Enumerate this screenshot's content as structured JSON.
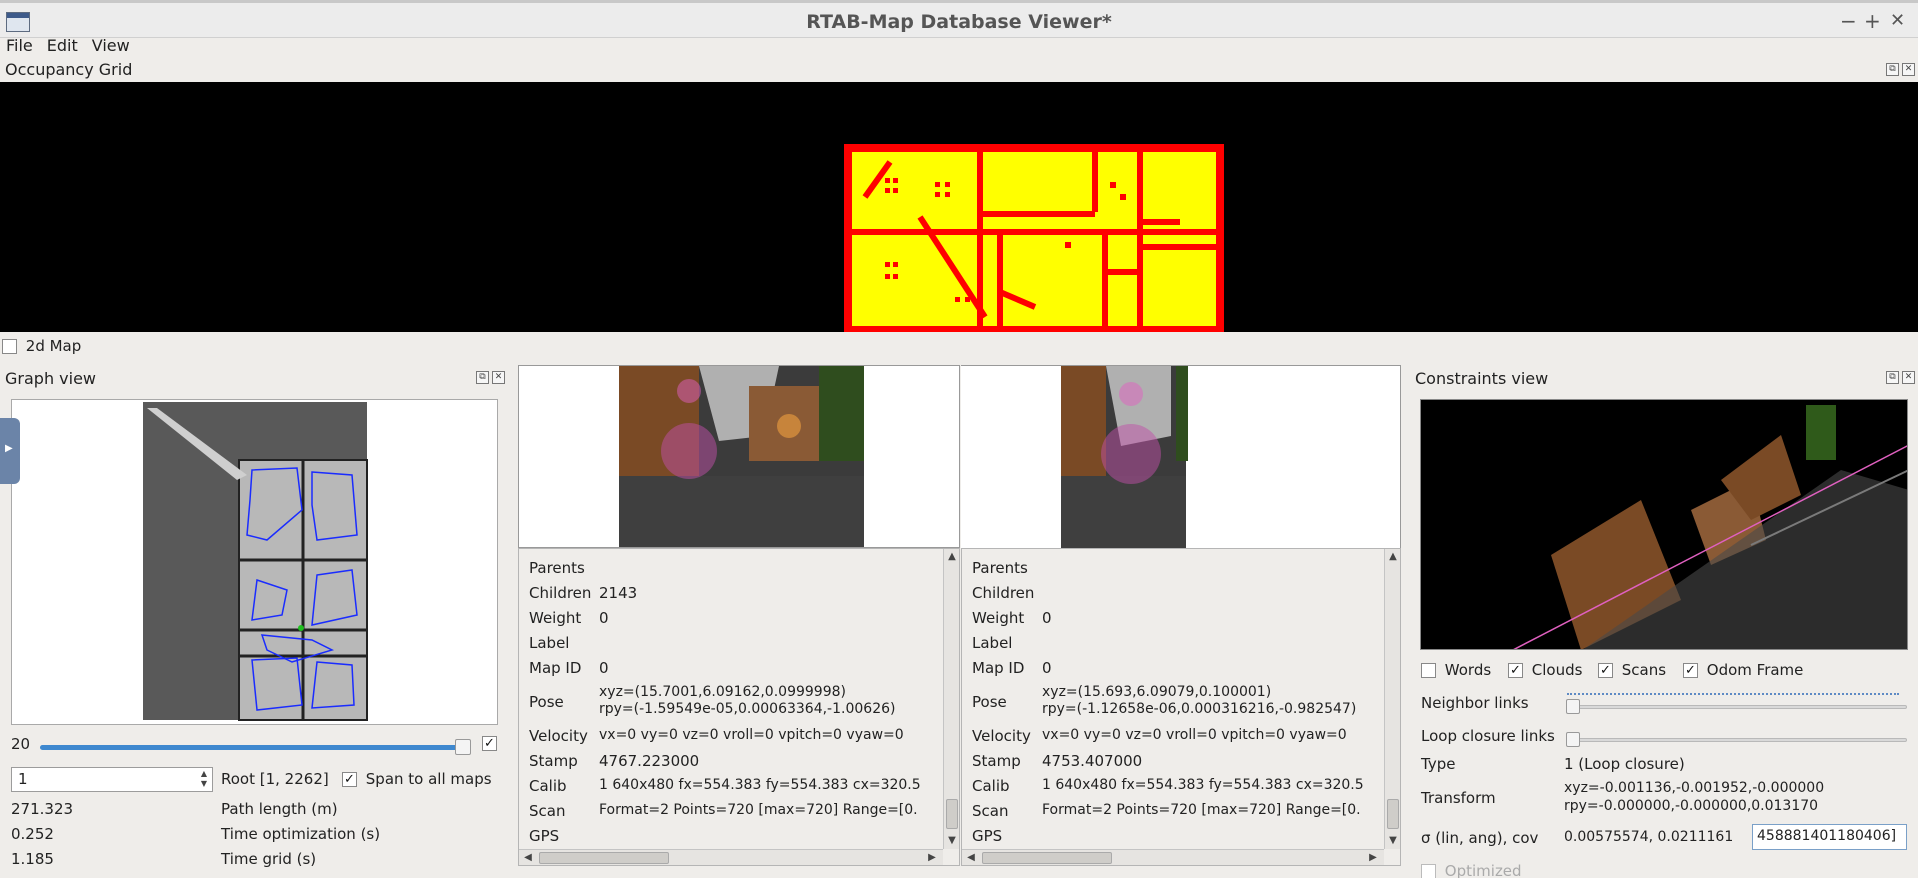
{
  "window": {
    "title": "RTAB-Map Database Viewer*",
    "minimize": "−",
    "maximize": "+",
    "close": "✕"
  },
  "menu": [
    "File",
    "Edit",
    "View"
  ],
  "occupancy": {
    "title": "Occupancy Grid",
    "map2d_label": "2d Map",
    "map2d_checked": false
  },
  "graph": {
    "title": "Graph view",
    "slider_value": "20",
    "root_spin_value": "1",
    "root_label": "Root [1, 2262]",
    "span_label": "Span to all maps",
    "span_checked": true,
    "stats": [
      {
        "value": "271.323",
        "label": "Path length (m)"
      },
      {
        "value": "0.252",
        "label": "Time optimization (s)"
      },
      {
        "value": "1.185",
        "label": "Time grid (s)"
      }
    ]
  },
  "node_left": {
    "rows": [
      {
        "key": "Parents",
        "val": ""
      },
      {
        "key": "Children",
        "val": "2143"
      },
      {
        "key": "Weight",
        "val": "0"
      },
      {
        "key": "Label",
        "val": ""
      },
      {
        "key": "Map ID",
        "val": "0"
      },
      {
        "key": "Pose",
        "val": "xyz=(15.7001,6.09162,0.0999998)",
        "val2": "rpy=(-1.59549e-05,0.00063364,-1.00626)"
      },
      {
        "key": "Velocity",
        "val": "vx=0 vy=0 vz=0 vroll=0 vpitch=0 vyaw=0"
      },
      {
        "key": "Stamp",
        "val": "4767.223000"
      },
      {
        "key": "Calib",
        "val": "1 640x480 fx=554.383 fy=554.383 cx=320.5"
      },
      {
        "key": "Scan",
        "val": "Format=2 Points=720 [max=720] Range=[0."
      },
      {
        "key": "GPS",
        "val": ""
      }
    ]
  },
  "node_right": {
    "rows": [
      {
        "key": "Parents",
        "val": ""
      },
      {
        "key": "Children",
        "val": ""
      },
      {
        "key": "Weight",
        "val": "0"
      },
      {
        "key": "Label",
        "val": ""
      },
      {
        "key": "Map ID",
        "val": "0"
      },
      {
        "key": "Pose",
        "val": "xyz=(15.693,6.09079,0.100001)",
        "val2": "rpy=(-1.12658e-06,0.000316216,-0.982547)"
      },
      {
        "key": "Velocity",
        "val": "vx=0 vy=0 vz=0 vroll=0 vpitch=0 vyaw=0"
      },
      {
        "key": "Stamp",
        "val": "4753.407000"
      },
      {
        "key": "Calib",
        "val": "1 640x480 fx=554.383 fy=554.383 cx=320.5"
      },
      {
        "key": "Scan",
        "val": "Format=2 Points=720 [max=720] Range=[0."
      },
      {
        "key": "GPS",
        "val": ""
      }
    ]
  },
  "constraints": {
    "title": "Constraints view",
    "checks": [
      {
        "label": "Words",
        "checked": false
      },
      {
        "label": "Clouds",
        "checked": true
      },
      {
        "label": "Scans",
        "checked": true
      },
      {
        "label": "Odom Frame",
        "checked": true
      }
    ],
    "neighbor_label": "Neighbor links",
    "loop_label": "Loop closure links",
    "type_label": "Type",
    "type_value": "1  (Loop closure)",
    "transform_label": "Transform",
    "transform_line1": "xyz=-0.001136,-0.001952,-0.000000",
    "transform_line2": "rpy=-0.000000,-0.000000,0.013170",
    "sigma_label": "σ (lin, ang), cov",
    "sigma_value": "0.00575574, 0.0211161",
    "cov_value": "458881401180406]",
    "optimized_label": "Optimized"
  }
}
